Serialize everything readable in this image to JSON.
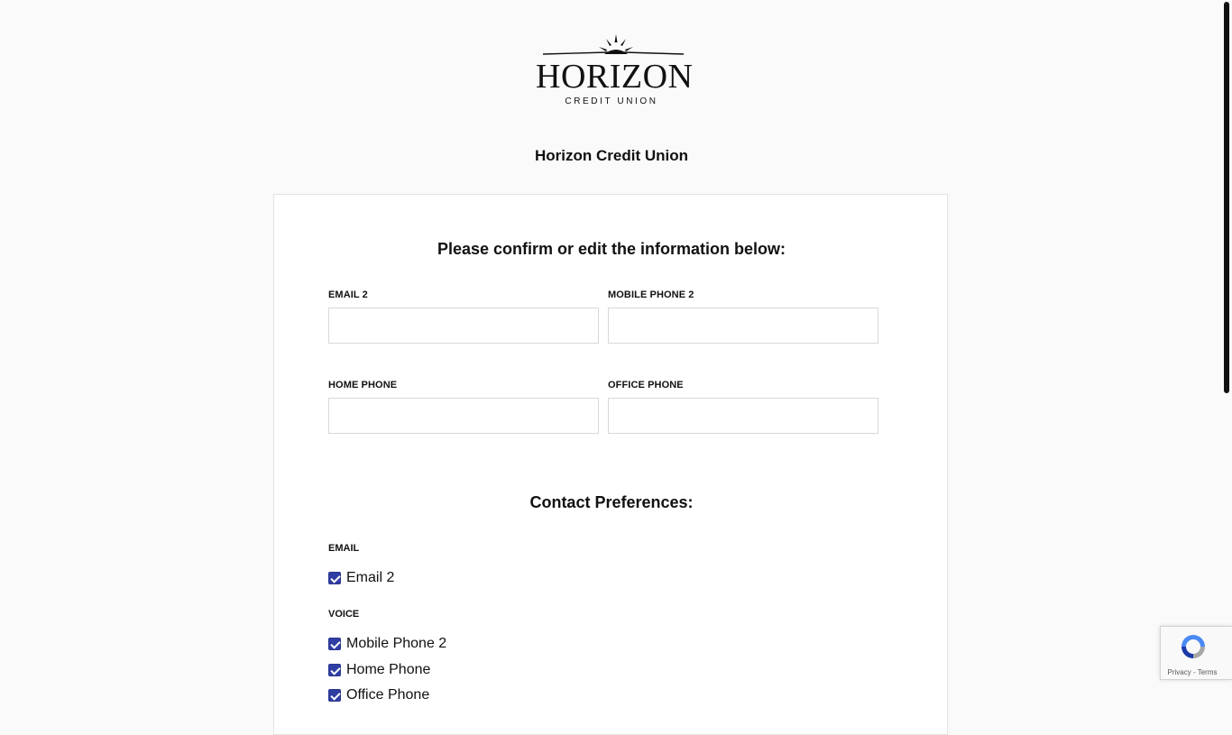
{
  "logo": {
    "word": "HORIZON",
    "tagline": "CREDIT UNION"
  },
  "org_title": "Horizon Credit Union",
  "form": {
    "heading": "Please confirm or edit the information below:",
    "fields": {
      "email2": {
        "label": "EMAIL 2",
        "value": ""
      },
      "mobile_phone2": {
        "label": "MOBILE PHONE 2",
        "value": ""
      },
      "home_phone": {
        "label": "HOME PHONE",
        "value": ""
      },
      "office_phone": {
        "label": "OFFICE PHONE",
        "value": ""
      }
    }
  },
  "preferences": {
    "heading": "Contact Preferences:",
    "email_group": {
      "label": "EMAIL",
      "options": [
        {
          "label": "Email 2",
          "checked": true
        }
      ]
    },
    "voice_group": {
      "label": "VOICE",
      "options": [
        {
          "label": "Mobile Phone 2",
          "checked": true
        },
        {
          "label": "Home Phone",
          "checked": true
        },
        {
          "label": "Office Phone",
          "checked": true
        }
      ]
    }
  },
  "recaptcha": {
    "links": "Privacy - Terms"
  },
  "colors": {
    "checkbox": "#2f3ea3",
    "background": "#fafafa",
    "card": "#ffffff"
  }
}
